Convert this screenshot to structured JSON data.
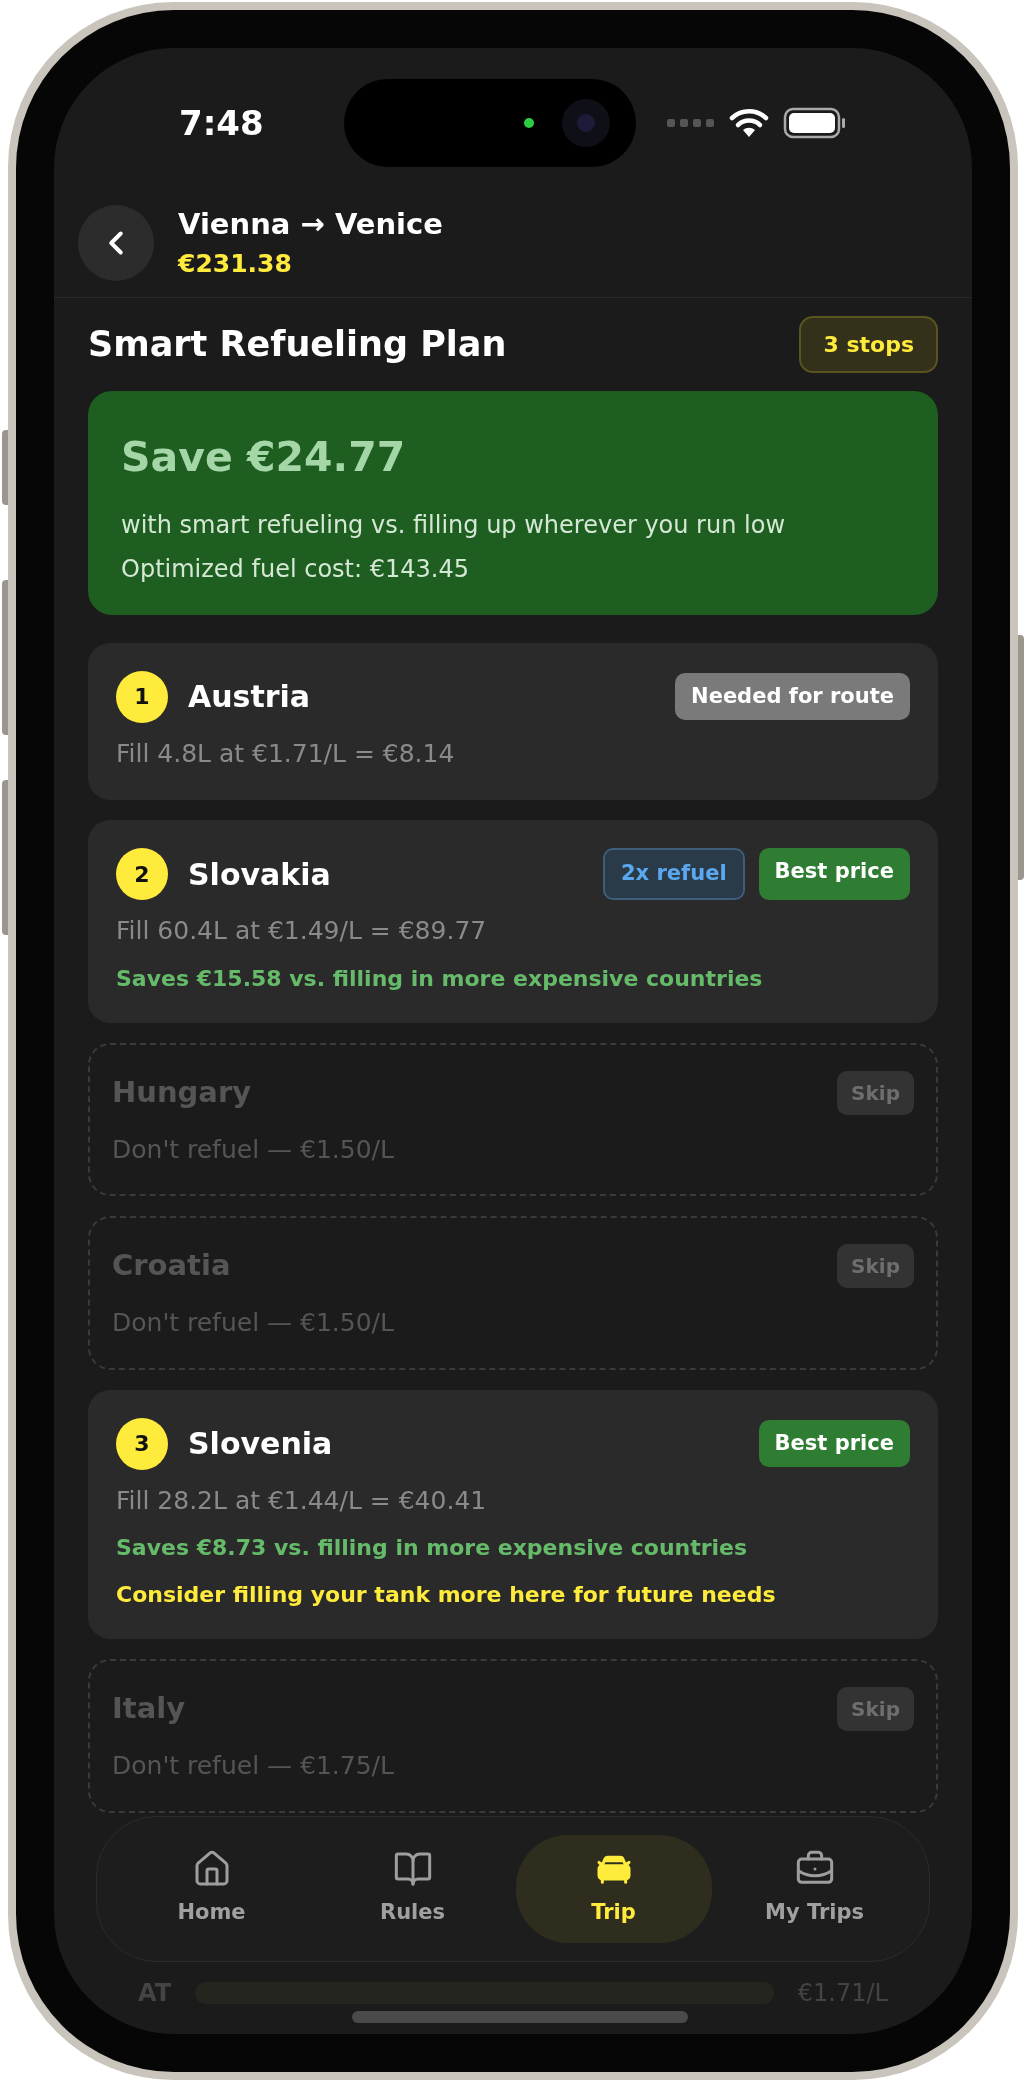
{
  "status_bar": {
    "time": "7:48"
  },
  "header": {
    "title": "Vienna → Venice",
    "total": "€231.38"
  },
  "plan": {
    "title": "Smart Refueling Plan",
    "badge": "3 stops"
  },
  "savings_card": {
    "headline": "Save €24.77",
    "subtitle": "with smart refueling vs. filling up wherever you run low",
    "cost": "Optimized fuel cost: €143.45"
  },
  "stops": [
    {
      "kind": "stop",
      "number": "1",
      "country": "Austria",
      "badges": [
        {
          "label": "Needed for route",
          "kind": "neutral"
        }
      ],
      "detail": "Fill 4.8L at €1.71/L = €8.14"
    },
    {
      "kind": "stop",
      "number": "2",
      "country": "Slovakia",
      "badges": [
        {
          "label": "2x refuel",
          "kind": "info"
        },
        {
          "label": "Best price",
          "kind": "success"
        }
      ],
      "detail": "Fill 60.4L at €1.49/L = €89.77",
      "savings": "Saves €15.58 vs. filling in more expensive countries"
    },
    {
      "kind": "skip",
      "country": "Hungary",
      "button": "Skip",
      "detail": "Don't refuel — €1.50/L"
    },
    {
      "kind": "skip",
      "country": "Croatia",
      "button": "Skip",
      "detail": "Don't refuel — €1.50/L"
    },
    {
      "kind": "stop",
      "number": "3",
      "country": "Slovenia",
      "badges": [
        {
          "label": "Best price",
          "kind": "success"
        }
      ],
      "detail": "Fill 28.2L at €1.44/L = €40.41",
      "savings": "Saves €8.73 vs. filling in more expensive countries",
      "tip": "Consider filling your tank more here for future needs"
    },
    {
      "kind": "skip",
      "country": "Italy",
      "button": "Skip",
      "detail": "Don't refuel — €1.75/L"
    }
  ],
  "comparison": {
    "rows": [
      {
        "code": "AT",
        "price": "€1.71/L"
      }
    ]
  },
  "nav": [
    {
      "label": "Home",
      "selected": false
    },
    {
      "label": "Rules",
      "selected": false
    },
    {
      "label": "Trip",
      "selected": true
    },
    {
      "label": "My Trips",
      "selected": false
    }
  ]
}
